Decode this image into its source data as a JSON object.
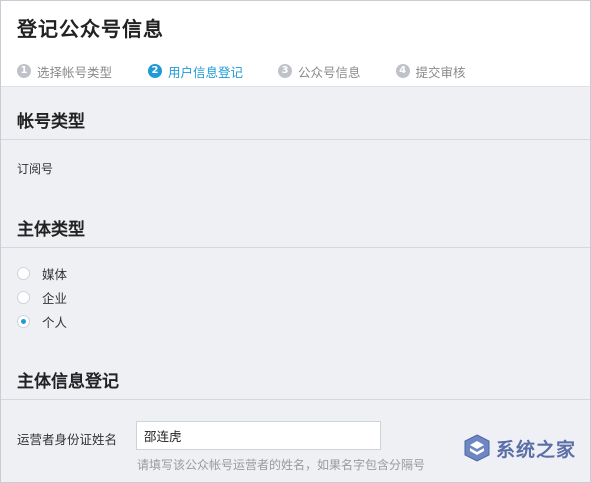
{
  "page": {
    "title": "登记公众号信息"
  },
  "steps": [
    {
      "num": "1",
      "label": "选择帐号类型",
      "active": false
    },
    {
      "num": "2",
      "label": "用户信息登记",
      "active": true
    },
    {
      "num": "3",
      "label": "公众号信息",
      "active": false
    },
    {
      "num": "4",
      "label": "提交审核",
      "active": false
    }
  ],
  "account_type": {
    "title": "帐号类型",
    "value": "订阅号"
  },
  "subject_type": {
    "title": "主体类型",
    "options": [
      {
        "label": "媒体",
        "checked": false
      },
      {
        "label": "企业",
        "checked": false
      },
      {
        "label": "个人",
        "checked": true
      }
    ]
  },
  "subject_info": {
    "title": "主体信息登记",
    "operator_name_label": "运营者身份证姓名",
    "operator_name_value": "邵连虎",
    "operator_name_hint": "请填写该公众帐号运营者的姓名，如果名字包含分隔号"
  },
  "watermark": {
    "text": "系统之家"
  },
  "colors": {
    "accent": "#1e9bd6",
    "background": "#eef0f4"
  }
}
